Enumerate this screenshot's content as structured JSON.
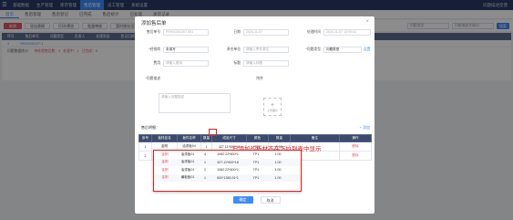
{
  "topnav": {
    "items": [
      "基础数据",
      "生产管理",
      "库存管理",
      "售后管理",
      "员工管理",
      "系统设置"
    ],
    "active_index": 3,
    "user": "问题描述反馈"
  },
  "tabs": [
    "首页",
    "售后管理",
    "售后登记",
    "已完成",
    "售后统计",
    "已处理",
    "发货记录"
  ],
  "toolbar": {
    "buttons": [
      "新增",
      "导出表格",
      "打印/预览",
      "批量审核",
      "暂时保存设置"
    ],
    "select_placeholder": "问题类型",
    "search_placeholder": "问题描述关键词",
    "search_label": "搜索"
  },
  "bglist": {
    "headers": [
      "序号",
      "售后单号",
      "问题类型",
      "负责人",
      "处理状态",
      "登记日期",
      "售后单位",
      "处理结果"
    ],
    "row": [
      "1",
      "SH20241107-1",
      "",
      "",
      "",
      "2024-11-07",
      "",
      ""
    ],
    "summary_prefix": "问题数据统计：",
    "summary_items": [
      "待处理售后数：0",
      "处理中：1",
      "已完成：0"
    ]
  },
  "dialog": {
    "title": "添加售后单",
    "close": "×",
    "fields": {
      "order_no_label": "售后单号",
      "order_no_value": "PSH20241107-001",
      "date_label": "日期",
      "date_value": "2024-11-07",
      "creator_label": "登记人",
      "creator_value": "",
      "handler_label": "处理时间",
      "handler_value": "2024-11-07 12:00:01",
      "customer_label": "*经销商",
      "customer_value": "未填写",
      "dept_label": "责任单位",
      "dept_placeholder": "请输入责任单位",
      "type_label": "*问题类型",
      "type_value": "问题类型",
      "setting_link": "设置",
      "cost_label": "费用",
      "cost_placeholder": "请输入费用",
      "title_label": "标题",
      "title_placeholder": "请输入标题",
      "desc_label": "*问题描述",
      "desc_placeholder": "请输入问题描述",
      "attach_label": "附件",
      "upload_text": "上传图片"
    },
    "detail_label": "售后明细：",
    "add_link": "+ 添加",
    "table_headers": [
      "序号",
      "板材品名",
      "板件名称",
      "数量",
      "成品尺寸",
      "颜色",
      "数量",
      "备注",
      "操作"
    ],
    "rows": [
      [
        "1",
        "金刚",
        "油漆板04",
        "1",
        "427.11*600*18",
        "TP1",
        "1.00",
        "",
        "删除"
      ],
      [
        "2",
        "",
        "",
        "",
        "",
        "",
        "",
        "",
        "删除"
      ]
    ],
    "ok_label": "确定",
    "cancel_label": "取消"
  },
  "annotation": "已添加的板材不在下拉列表中显示",
  "dropdown_rows": [
    [
      "金刚",
      "油漆板01",
      "4",
      "1082.22*600*1",
      "TP1",
      "1.00"
    ],
    [
      "金刚",
      "油漆板01",
      "1",
      "427.11*600*18",
      "TP1",
      "1.00"
    ],
    [
      "金刚",
      "油漆板01",
      "2",
      "1082.22*600*1",
      "TP1",
      "1.00"
    ],
    [
      "金刚",
      "横板板01",
      "1",
      "600*1365.91*1",
      "TP1",
      "1.00"
    ]
  ],
  "colors": {
    "accent": "#3d8bfd",
    "highlight": "#e02020",
    "nav_bg": "#2b3a67"
  }
}
